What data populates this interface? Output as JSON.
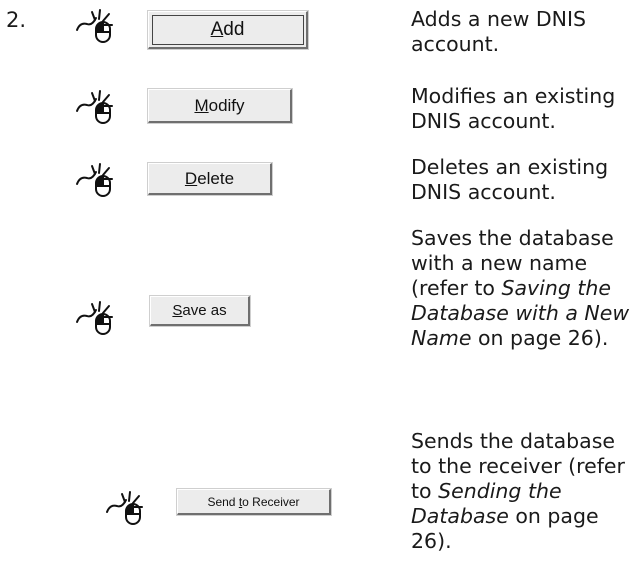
{
  "step_number": "2.",
  "icons": {
    "mouse": "mouse-click-icon"
  },
  "rows": [
    {
      "button": {
        "acc": "A",
        "rest": "dd"
      },
      "description": [
        {
          "t": "Adds a new DNIS account.",
          "i": false
        }
      ]
    },
    {
      "button": {
        "acc": "M",
        "rest": "odify"
      },
      "description": [
        {
          "t": "Modifies an existing DNIS account.",
          "i": false
        }
      ]
    },
    {
      "button": {
        "acc": "D",
        "rest": "elete"
      },
      "description": [
        {
          "t": "Deletes an existing DNIS account.",
          "i": false
        }
      ]
    },
    {
      "button": {
        "acc": "S",
        "rest": "ave as"
      },
      "description": [
        {
          "t": "Saves the database with a new name (refer to ",
          "i": false
        },
        {
          "t": "Saving the Database with a New Name",
          "i": true
        },
        {
          "t": " on page 26).",
          "i": false
        }
      ]
    },
    {
      "button": {
        "pre": "Send ",
        "acc": "t",
        "rest": "o Receiver"
      },
      "description": [
        {
          "t": "Sends the database to the receiver (refer to ",
          "i": false
        },
        {
          "t": "Sending the Database",
          "i": true
        },
        {
          "t": " on page 26).",
          "i": false
        }
      ]
    }
  ]
}
